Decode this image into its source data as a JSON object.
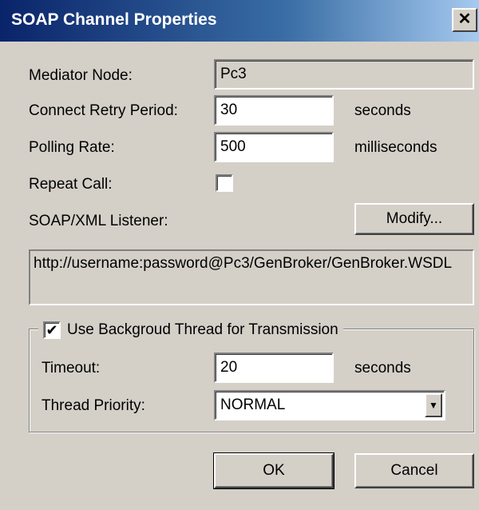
{
  "window": {
    "title": "SOAP Channel Properties",
    "close_glyph": "✕"
  },
  "form": {
    "mediator_node": {
      "label": "Mediator Node:",
      "value": "Pc3"
    },
    "connect_retry": {
      "label": "Connect Retry Period:",
      "value": "30",
      "unit": "seconds"
    },
    "polling_rate": {
      "label": "Polling Rate:",
      "value": "500",
      "unit": "milliseconds"
    },
    "repeat_call": {
      "label": "Repeat Call:",
      "checked": false
    },
    "listener": {
      "label": "SOAP/XML Listener:",
      "modify_label": "Modify...",
      "url": "http://username:password@Pc3/GenBroker/GenBroker.WSDL"
    }
  },
  "background_thread": {
    "label": "Use Backgroud Thread for Transmission",
    "checked": true,
    "check_glyph": "✔",
    "timeout": {
      "label": "Timeout:",
      "value": "20",
      "unit": "seconds"
    },
    "thread_priority": {
      "label": "Thread Priority:",
      "value": "NORMAL"
    }
  },
  "buttons": {
    "ok": "OK",
    "cancel": "Cancel"
  },
  "colors": {
    "face": "#d4d0c8",
    "title_start": "#0a246a",
    "title_end": "#a6caf0"
  },
  "icons": {
    "close": "close-icon",
    "dropdown": "chevron-down-icon",
    "check": "checkmark-icon"
  }
}
